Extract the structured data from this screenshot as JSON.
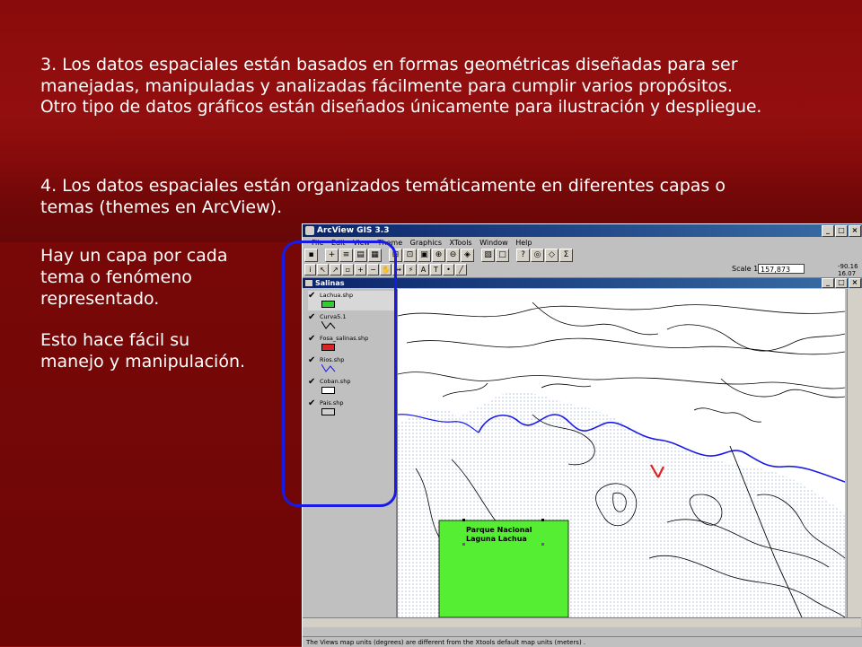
{
  "slide": {
    "paragraph3": [
      "3. Los datos espaciales están basados en formas geométricas diseñadas para ser",
      "manejadas, manipuladas y analizadas fácilmente para cumplir varios propósitos.",
      "Otro tipo de datos gráficos están diseñados únicamente para ilustración y despliegue."
    ],
    "paragraph4": [
      "4. Los datos espaciales están organizados temáticamente en diferentes capas o",
      "temas (themes en ArcView)."
    ],
    "side_text1": [
      "Hay un capa por cada",
      "tema o fenómeno",
      "representado."
    ],
    "side_text2": [
      "Esto hace fácil su",
      "manejo y manipulación."
    ]
  },
  "app": {
    "title": "ArcView GIS 3.3",
    "menu": [
      "File",
      "Edit",
      "View",
      "Theme",
      "Graphics",
      "XTools",
      "Window",
      "Help"
    ],
    "scale_label": "Scale 1:",
    "scale_value": "157,873",
    "coord_x": "-90.16",
    "coord_y": "16.07",
    "status": "The Views map units (degrees) are different from the Xtools default map units (meters) ."
  },
  "view": {
    "title": "Salinas",
    "themes": [
      {
        "name": "Lachua.shp",
        "swatch": "#33cc33",
        "kind": "fill"
      },
      {
        "name": "Curva5.1",
        "swatch": "#000000",
        "kind": "line"
      },
      {
        "name": "Fosa_salinas.shp",
        "swatch": "#dd2222",
        "kind": "fill"
      },
      {
        "name": "Rios.shp",
        "swatch": "#1a1ae6",
        "kind": "line"
      },
      {
        "name": "Coban.shp",
        "swatch": "#ffffff",
        "kind": "fill"
      },
      {
        "name": "Pais.shp",
        "swatch": "#d0d0d0",
        "kind": "fill"
      }
    ],
    "map_label_line1": "Parque Nacional",
    "map_label_line2": "Laguna Lachua"
  },
  "colors": {
    "slide_bg": "#7a0808",
    "highlight": "#1a1ae6",
    "park_fill": "#55ee33",
    "river": "#1a1ae6"
  }
}
